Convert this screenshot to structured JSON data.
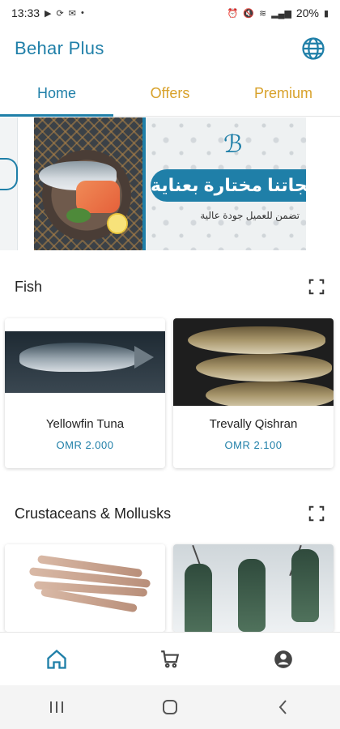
{
  "status_bar": {
    "time": "13:33",
    "battery": "20%"
  },
  "app_bar": {
    "title": "Behar Plus",
    "language_icon": "globe-icon"
  },
  "tabs": [
    {
      "label": "Home",
      "active": true
    },
    {
      "label": "Offers",
      "active": false
    },
    {
      "label": "Premium",
      "active": false
    }
  ],
  "banner": {
    "headline": "تجاتنا مختارة بعناية",
    "subline": "تضمن للعميل جودة عالية"
  },
  "sections": [
    {
      "title": "Fish",
      "expand_icon": "fullscreen-icon",
      "items": [
        {
          "name": "Yellowfin Tuna",
          "price": "OMR 2.000"
        },
        {
          "name": "Trevally Qishran",
          "price": "OMR 2.100"
        }
      ]
    },
    {
      "title": "Crustaceans & Mollusks",
      "expand_icon": "fullscreen-icon",
      "items": [
        {
          "name": "",
          "price": ""
        },
        {
          "name": "",
          "price": ""
        }
      ]
    }
  ],
  "bottom_nav": [
    {
      "icon": "home-icon",
      "active": true
    },
    {
      "icon": "cart-icon",
      "active": false
    },
    {
      "icon": "account-icon",
      "active": false
    }
  ],
  "colors": {
    "primary": "#1f7fa8",
    "accent": "#d8a12a"
  }
}
